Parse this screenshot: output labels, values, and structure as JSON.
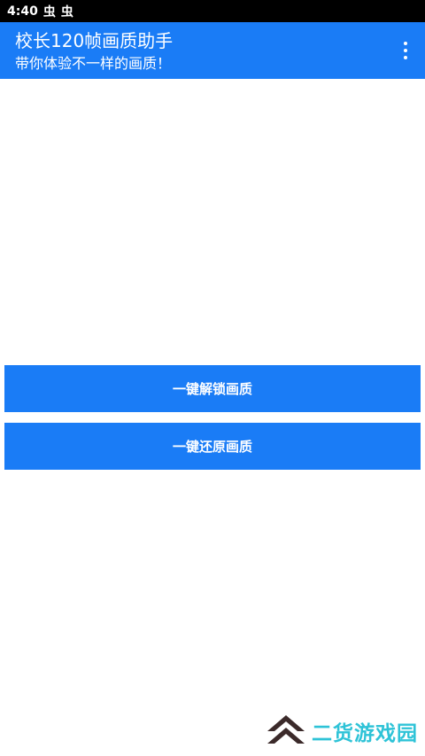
{
  "status_bar": {
    "time": "4:40",
    "notification_icons": [
      "bug-icon",
      "bug-icon"
    ],
    "notification_glyph": "虫"
  },
  "app_bar": {
    "title": "校长120帧画质助手",
    "subtitle": "带你体验不一样的画质！",
    "background_color": "#1a7cf6",
    "menu_icon": "more-vert-icon"
  },
  "main": {
    "buttons": [
      {
        "label": "一键解锁画质"
      },
      {
        "label": "一键还原画质"
      }
    ],
    "button_color": "#1a7cf6"
  },
  "watermark": {
    "text": "二货游戏园",
    "text_color": "#2ec3d7",
    "logo_color": "#3b2a2a"
  }
}
